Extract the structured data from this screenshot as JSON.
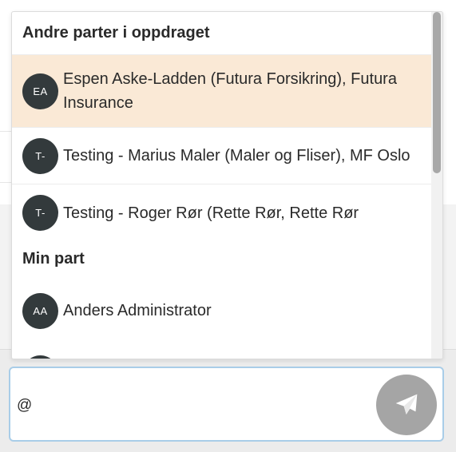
{
  "mention_dropdown": {
    "sections": [
      {
        "header": "Andre parter i oppdraget",
        "items": [
          {
            "initials": "EA",
            "label": "Espen Aske-Ladden (Futura Forsikring), Futura Insurance",
            "selected": true
          },
          {
            "initials": "T-",
            "label": "Testing - Marius Maler (Maler og Fliser), MF Oslo",
            "selected": false
          },
          {
            "initials": "T-",
            "label": "Testing - Roger Rør (Rette Rør, Rette Rør",
            "selected": false
          }
        ]
      },
      {
        "header": "Min part",
        "items": [
          {
            "initials": "AA",
            "label": "Anders Administrator",
            "selected": false
          }
        ]
      }
    ]
  },
  "composer": {
    "value": "@",
    "send_icon": "paper-plane-icon"
  },
  "colors": {
    "selected_row": "#fae9d6",
    "avatar_bg": "#333a3c",
    "send_button_bg": "#a5a5a5",
    "input_border": "#a9cde8"
  }
}
